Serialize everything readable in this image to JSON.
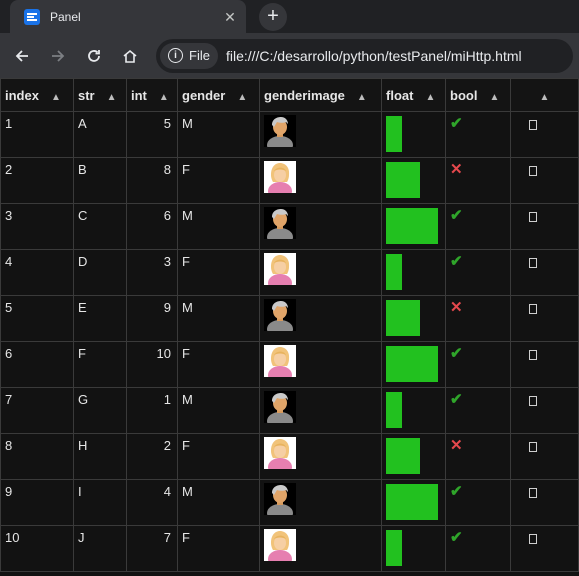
{
  "browser": {
    "tab_title": "Panel",
    "tab_close": "✕",
    "new_tab": "+",
    "site_chip": "File",
    "url": "file:///C:/desarrollo/python/testPanel/miHttp.html"
  },
  "table": {
    "columns": [
      "index",
      "str",
      "int",
      "gender",
      "genderimage",
      "float",
      "bool",
      ""
    ],
    "sort_glyph": "▲",
    "rows": [
      {
        "index": "1",
        "str": "A",
        "int": "5",
        "gender": "M",
        "float": 0.3,
        "bool": true
      },
      {
        "index": "2",
        "str": "B",
        "int": "8",
        "gender": "F",
        "float": 0.65,
        "bool": false
      },
      {
        "index": "3",
        "str": "C",
        "int": "6",
        "gender": "M",
        "float": 1.0,
        "bool": true
      },
      {
        "index": "4",
        "str": "D",
        "int": "3",
        "gender": "F",
        "float": 0.3,
        "bool": true
      },
      {
        "index": "5",
        "str": "E",
        "int": "9",
        "gender": "M",
        "float": 0.65,
        "bool": false
      },
      {
        "index": "6",
        "str": "F",
        "int": "10",
        "gender": "F",
        "float": 1.0,
        "bool": true
      },
      {
        "index": "7",
        "str": "G",
        "int": "1",
        "gender": "M",
        "float": 0.3,
        "bool": true
      },
      {
        "index": "8",
        "str": "H",
        "int": "2",
        "gender": "F",
        "float": 0.65,
        "bool": false
      },
      {
        "index": "9",
        "str": "I",
        "int": "4",
        "gender": "M",
        "float": 1.0,
        "bool": true
      },
      {
        "index": "10",
        "str": "J",
        "int": "7",
        "gender": "F",
        "float": 0.3,
        "bool": true
      }
    ],
    "true_glyph": "✔",
    "false_glyph": "✕",
    "colors": {
      "bar": "#22c11f",
      "true": "#2fa52a",
      "false": "#e5484d"
    }
  }
}
